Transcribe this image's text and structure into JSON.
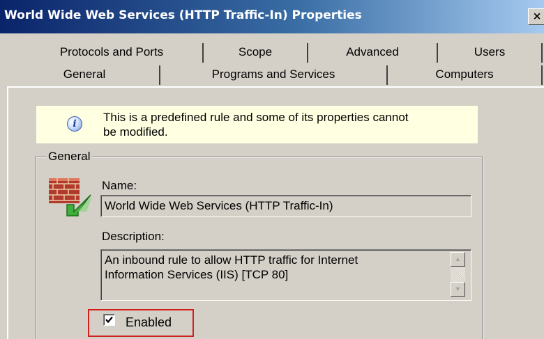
{
  "window": {
    "title": "World Wide Web Services (HTTP Traffic-In) Properties",
    "close_label": "×"
  },
  "tabs": {
    "row1": [
      "Protocols and Ports",
      "Scope",
      "Advanced",
      "Users"
    ],
    "row2": [
      "General",
      "Programs and Services",
      "Computers"
    ],
    "active": "General"
  },
  "info": {
    "icon": "info-icon",
    "glyph": "i",
    "line1": "This is a predefined rule and some of its properties cannot",
    "line2": "be modified."
  },
  "general_group": {
    "legend": "General",
    "icon": "firewall-icon",
    "name_label": "Name:",
    "name_value": "World Wide Web Services (HTTP Traffic-In)",
    "description_label": "Description:",
    "description_line1": "An inbound rule to allow HTTP traffic for Internet",
    "description_line2": "Information Services (IIS) [TCP 80]",
    "enabled_label": "Enabled",
    "enabled_checked": true
  },
  "colors": {
    "title_bar_start": "#0a246a",
    "title_bar_end": "#a6caf0",
    "info_background": "#ffffe1",
    "highlight_border": "#d21f1f",
    "dialog_face": "#d4d0c8"
  }
}
